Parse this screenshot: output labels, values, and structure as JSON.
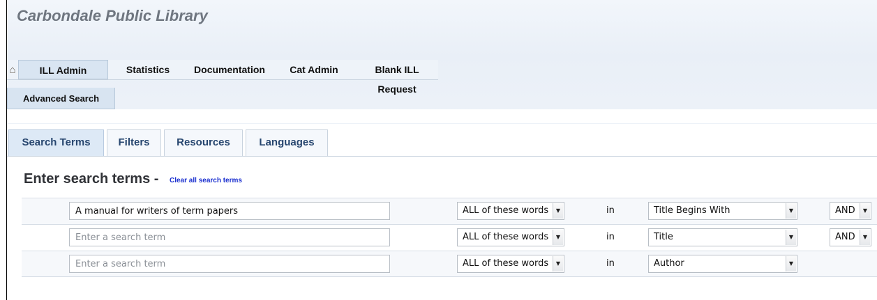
{
  "app": {
    "title": "Carbondale Public Library"
  },
  "nav": {
    "home_icon": "home-icon",
    "items": [
      {
        "label": "ILL Admin"
      },
      {
        "label": "Statistics"
      },
      {
        "label": "Documentation"
      },
      {
        "label": "Cat Admin"
      },
      {
        "label": "Blank ILL",
        "label_line2": "Request"
      }
    ],
    "active_index": 0
  },
  "subnav": {
    "advanced_search_label": "Advanced Search"
  },
  "search_tabs": {
    "items": [
      {
        "label": "Search Terms"
      },
      {
        "label": "Filters"
      },
      {
        "label": "Resources"
      },
      {
        "label": "Languages"
      }
    ],
    "active_index": 0
  },
  "search_terms": {
    "heading": "Enter search terms - ",
    "clear_link": "Clear all search terms",
    "placeholder": "Enter a search term",
    "in_label": "in",
    "rows": [
      {
        "term": "A manual for writers of term papers",
        "match": "ALL of these words",
        "field": "Title Begins With",
        "operator": "AND"
      },
      {
        "term": "",
        "match": "ALL of these words",
        "field": "Title",
        "operator": "AND"
      },
      {
        "term": "",
        "match": "ALL of these words",
        "field": "Author",
        "operator": null
      }
    ]
  },
  "colors": {
    "header_bg": "#eef3f9",
    "active_tab_bg": "#d9e5f2",
    "tab_text": "#27466f",
    "link": "#1a2fcf"
  }
}
